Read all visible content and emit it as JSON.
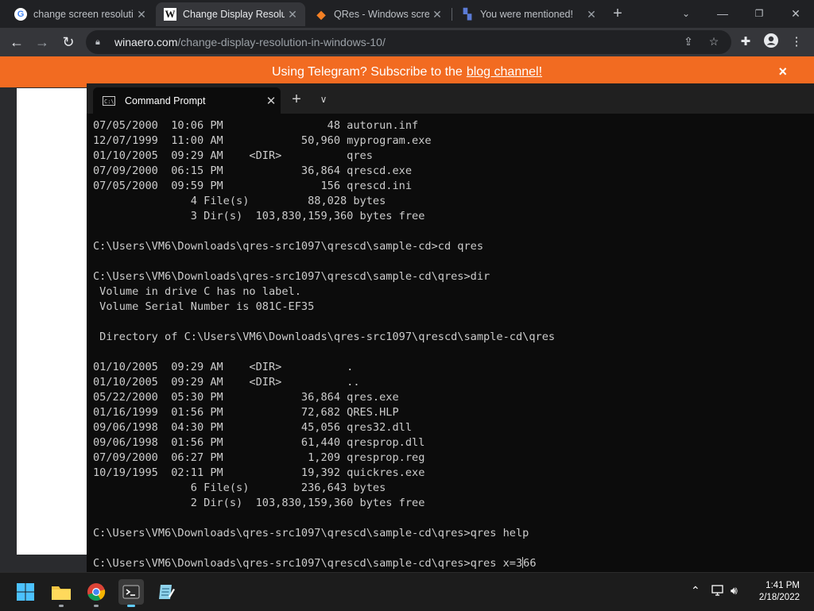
{
  "browser": {
    "tabs": [
      {
        "title": "change screen resolution",
        "favicon": "G"
      },
      {
        "title": "Change Display Resolution",
        "favicon": "W"
      },
      {
        "title": "QRes - Windows screen",
        "favicon": "◆"
      },
      {
        "title": "You were mentioned!",
        "favicon": "▚"
      }
    ],
    "active_tab": 1,
    "url_host": "winaero.com",
    "url_path": "/change-display-resolution-in-windows-10/",
    "icons": [
      "back-icon",
      "forward-icon",
      "reload-icon",
      "lock-icon",
      "share-icon",
      "star-icon",
      "extensions-icon",
      "profile-icon",
      "menu-icon"
    ]
  },
  "banner": {
    "text": "Using Telegram? Subscribe to the",
    "link": "blog channel!",
    "close": "×"
  },
  "terminal": {
    "tab_title": "Command Prompt",
    "lines": [
      "07/05/2000  10:06 PM                48 autorun.inf",
      "12/07/1999  11:00 AM            50,960 myprogram.exe",
      "01/10/2005  09:29 AM    <DIR>          qres",
      "07/09/2000  06:15 PM            36,864 qrescd.exe",
      "07/05/2000  09:59 PM               156 qrescd.ini",
      "               4 File(s)         88,028 bytes",
      "               3 Dir(s)  103,830,159,360 bytes free",
      "",
      "C:\\Users\\VM6\\Downloads\\qres-src1097\\qrescd\\sample-cd>cd qres",
      "",
      "C:\\Users\\VM6\\Downloads\\qres-src1097\\qrescd\\sample-cd\\qres>dir",
      " Volume in drive C has no label.",
      " Volume Serial Number is 081C-EF35",
      "",
      " Directory of C:\\Users\\VM6\\Downloads\\qres-src1097\\qrescd\\sample-cd\\qres",
      "",
      "01/10/2005  09:29 AM    <DIR>          .",
      "01/10/2005  09:29 AM    <DIR>          ..",
      "05/22/2000  05:30 PM            36,864 qres.exe",
      "01/16/1999  01:56 PM            72,682 QRES.HLP",
      "09/06/1998  04:30 PM            45,056 qres32.dll",
      "09/06/1998  01:56 PM            61,440 qresprop.dll",
      "07/09/2000  06:27 PM             1,209 qresprop.reg",
      "10/19/1995  02:11 PM            19,392 quickres.exe",
      "               6 File(s)        236,643 bytes",
      "               2 Dir(s)  103,830,159,360 bytes free",
      "",
      "C:\\Users\\VM6\\Downloads\\qres-src1097\\qrescd\\sample-cd\\qres>qres help",
      ""
    ],
    "input_line_before_cursor": "C:\\Users\\VM6\\Downloads\\qres-src1097\\qrescd\\sample-cd\\qres>qres x=3",
    "input_line_after_cursor": "66"
  },
  "taskbar": {
    "apps": [
      "start-icon",
      "file-explorer-icon",
      "chrome-icon",
      "terminal-icon",
      "notepad-icon"
    ],
    "active_app": 3,
    "time": "1:41 PM",
    "date": "2/18/2022"
  },
  "colors": {
    "banner": "#f26b21",
    "terminal_bg": "#0c0c0c",
    "terminal_text": "#cccccc",
    "chrome_dark": "#202124"
  }
}
